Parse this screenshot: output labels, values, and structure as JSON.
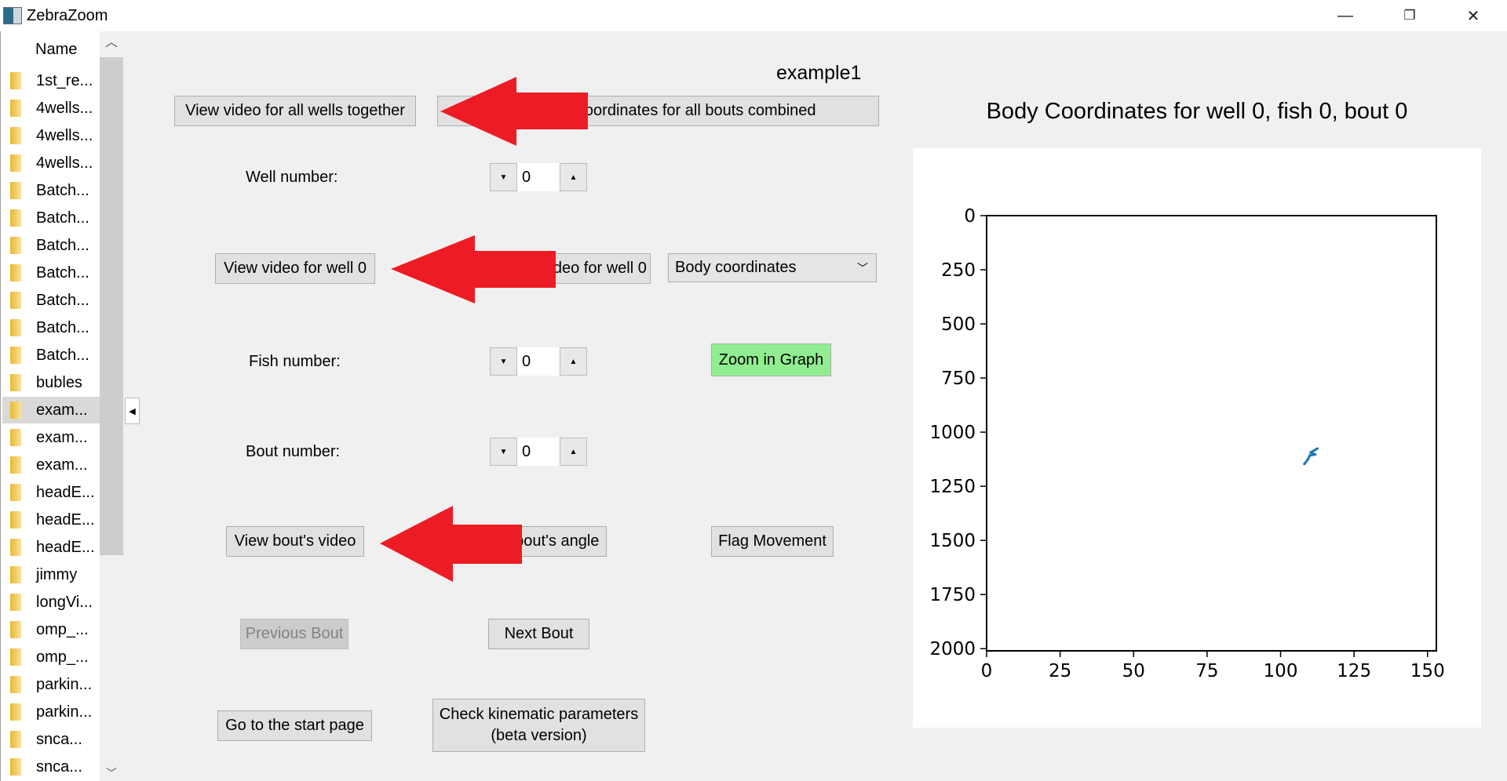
{
  "window": {
    "title": "ZebraZoom",
    "minimize": "—",
    "restore": "❐",
    "close": "✕"
  },
  "sidebar": {
    "header": "Name",
    "selected_index": 12,
    "items": [
      "1st_re...",
      "4wells...",
      "4wells...",
      "4wells...",
      "Batch...",
      "Batch...",
      "Batch...",
      "Batch...",
      "Batch...",
      "Batch...",
      "Batch...",
      "bubles",
      "exam...",
      "exam...",
      "exam...",
      "headE...",
      "headE...",
      "headE...",
      "jimmy",
      "longVi...",
      "omp_...",
      "omp_...",
      "parkin...",
      "parkin...",
      "snca...",
      "snca..."
    ]
  },
  "main": {
    "experiment_name": "example1",
    "view_all_wells_button": "View video for all wells together",
    "body_coords_all_bouts_button": "View body coordinates for all bouts combined",
    "well_label": "Well number:",
    "well_value": "0",
    "view_well_button": "View video for well 0",
    "view_zoomed_well_button": "View zoomed video for well 0",
    "graph_type_select": "Body coordinates",
    "fish_label": "Fish number:",
    "fish_value": "0",
    "zoom_graph_button": "Zoom in Graph",
    "bout_label": "Bout number:",
    "bout_value": "0",
    "view_bout_button": "View bout's video",
    "view_bout_angle_button": "View bout's angle",
    "flag_movement_button": "Flag Movement",
    "previous_bout_button": "Previous Bout",
    "next_bout_button": "Next Bout",
    "start_page_button": "Go to the start page",
    "kinematic_button_line1": "Check kinematic parameters",
    "kinematic_button_line2": "(beta version)"
  },
  "colors": {
    "annotation_arrow": "#ed1c24",
    "zoom_button": "#90ee90",
    "series": "#1f77b4"
  },
  "chart_data": {
    "type": "line",
    "title": "Body Coordinates for well 0, fish 0, bout 0",
    "xlabel": "",
    "ylabel": "",
    "xlim": [
      0,
      153
    ],
    "ylim": [
      2010,
      0
    ],
    "y_inverted": true,
    "grid": false,
    "xticks": [
      0,
      25,
      50,
      75,
      100,
      125,
      150
    ],
    "yticks": [
      0,
      250,
      500,
      750,
      1000,
      1250,
      1500,
      1750,
      2000
    ],
    "series": [
      {
        "x": [
          108.1,
          109.3,
          109.9,
          111.8,
          110.2,
          112.5
        ],
        "y": [
          1147,
          1126,
          1108,
          1103,
          1094,
          1076
        ]
      }
    ]
  }
}
